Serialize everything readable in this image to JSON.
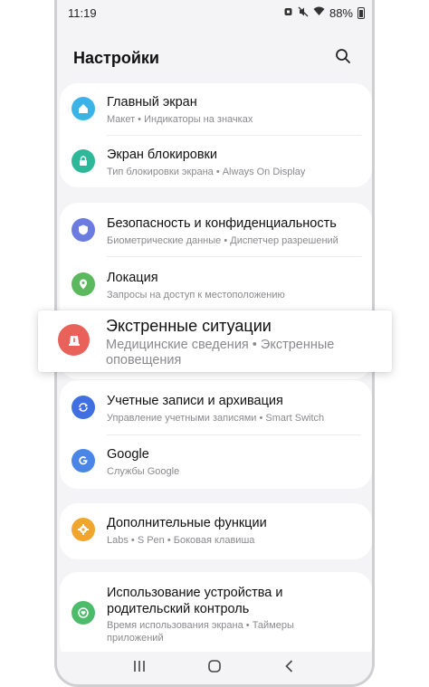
{
  "status_bar": {
    "time": "11:19",
    "battery": "88%",
    "icons": [
      "alarm-icon",
      "mute-icon",
      "wifi-icon",
      "battery-icon"
    ]
  },
  "header": {
    "title": "Настройки",
    "search_icon": "search-icon"
  },
  "items": {
    "home": {
      "title": "Главный экран",
      "subtitle": "Макет • Индикаторы на значках",
      "icon": "home-icon",
      "color": "#3bb3e6"
    },
    "lock": {
      "title": "Экран блокировки",
      "subtitle": "Тип блокировки экрана • Always On Display",
      "icon": "lock-icon",
      "color": "#2eb89a"
    },
    "security": {
      "title": "Безопасность и конфиденциальность",
      "subtitle": "Биометрические данные • Диспетчер разрешений",
      "icon": "shield-icon",
      "color": "#6b7be0"
    },
    "location": {
      "title": "Локация",
      "subtitle": "Запросы на доступ к местоположению",
      "icon": "location-pin-icon",
      "color": "#5cb85c"
    },
    "emergency": {
      "title": "Экстренные ситуации",
      "subtitle_line1": "Медицинские сведения • Экстренные",
      "subtitle_line2": "оповещения",
      "icon": "emergency-icon",
      "color": "#e8625a"
    },
    "accounts": {
      "title": "Учетные записи и архивация",
      "subtitle": "Управление учетными записями • Smart Switch",
      "icon": "sync-icon",
      "color": "#3f6fe0"
    },
    "google": {
      "title": "Google",
      "subtitle": "Службы Google",
      "icon": "google-icon",
      "color": "#4a86e8"
    },
    "advanced": {
      "title": "Дополнительные функции",
      "subtitle": "Labs • S Pen • Боковая клавиша",
      "icon": "gear-plus-icon",
      "color": "#f0a52e"
    },
    "wellbeing": {
      "title_line1": "Использование устройства и",
      "title_line2": "родительский контроль",
      "subtitle_line1": "Время использования экрана • Таймеры",
      "subtitle_line2": "приложений",
      "icon": "wellbeing-icon",
      "color": "#4cbb6a"
    }
  },
  "nav": [
    "recents-icon",
    "home-button-icon",
    "back-icon"
  ]
}
